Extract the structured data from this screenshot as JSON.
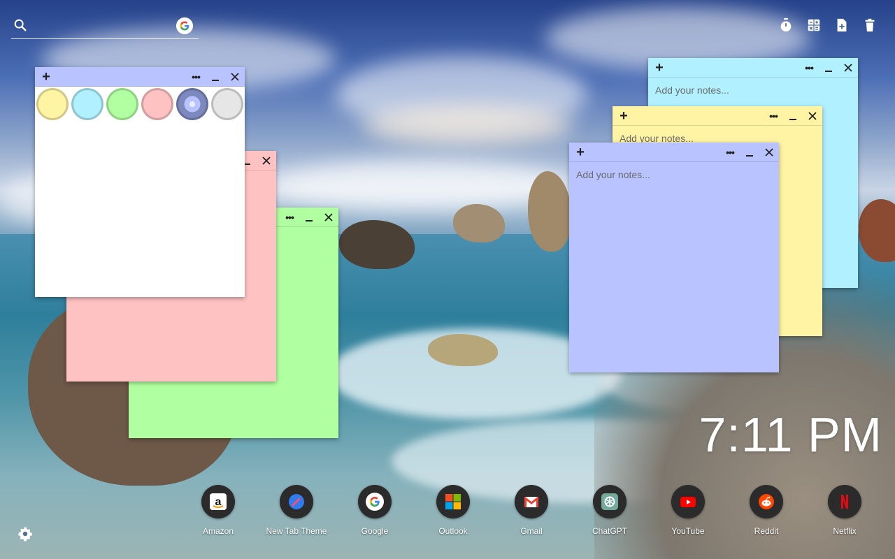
{
  "search": {
    "placeholder": ""
  },
  "toolbar": {
    "buttons": [
      {
        "icon": "timer-icon"
      },
      {
        "icon": "calculator-icon"
      },
      {
        "icon": "new-note-icon"
      },
      {
        "icon": "trash-icon"
      }
    ]
  },
  "colors": {
    "yellow": "#fff4a3",
    "cyan": "#b0f0ff",
    "green": "#b0ffa0",
    "pink": "#ffc2c2",
    "lavender": "#b9c3ff",
    "gray": "#e6e6e6",
    "white": "#ffffff"
  },
  "notes": {
    "placeholder": "Add your notes...",
    "more_label": "•••",
    "add_label": "+",
    "swatches": [
      "yellow",
      "cyan",
      "green",
      "pink",
      "lavender",
      "gray"
    ]
  },
  "clock": {
    "time": "7:11 PM"
  },
  "shortcuts": [
    {
      "label": "Amazon",
      "icon": "amazon-icon"
    },
    {
      "label": "New Tab Theme",
      "icon": "new-tab-theme-icon"
    },
    {
      "label": "Google",
      "icon": "google-icon"
    },
    {
      "label": "Outlook",
      "icon": "outlook-icon"
    },
    {
      "label": "Gmail",
      "icon": "gmail-icon"
    },
    {
      "label": "ChatGPT",
      "icon": "chatgpt-icon"
    },
    {
      "label": "YouTube",
      "icon": "youtube-icon"
    },
    {
      "label": "Reddit",
      "icon": "reddit-icon"
    },
    {
      "label": "Netflix",
      "icon": "netflix-icon"
    }
  ]
}
